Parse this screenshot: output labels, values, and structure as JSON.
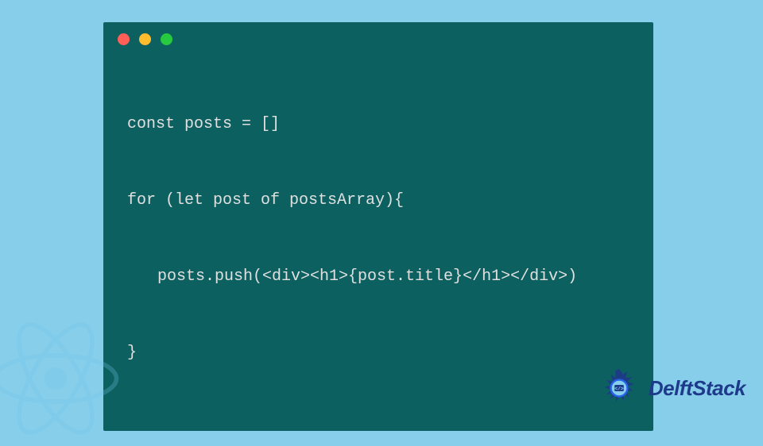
{
  "code": {
    "line1": "const posts = []",
    "line2": "for (let post of postsArray){",
    "line3": "posts.push(<div><h1>{post.title}</h1></div>)",
    "line4": "}"
  },
  "brand": {
    "name": "DelftStack"
  },
  "window": {
    "dot_red": "close",
    "dot_yellow": "minimize",
    "dot_green": "maximize"
  }
}
